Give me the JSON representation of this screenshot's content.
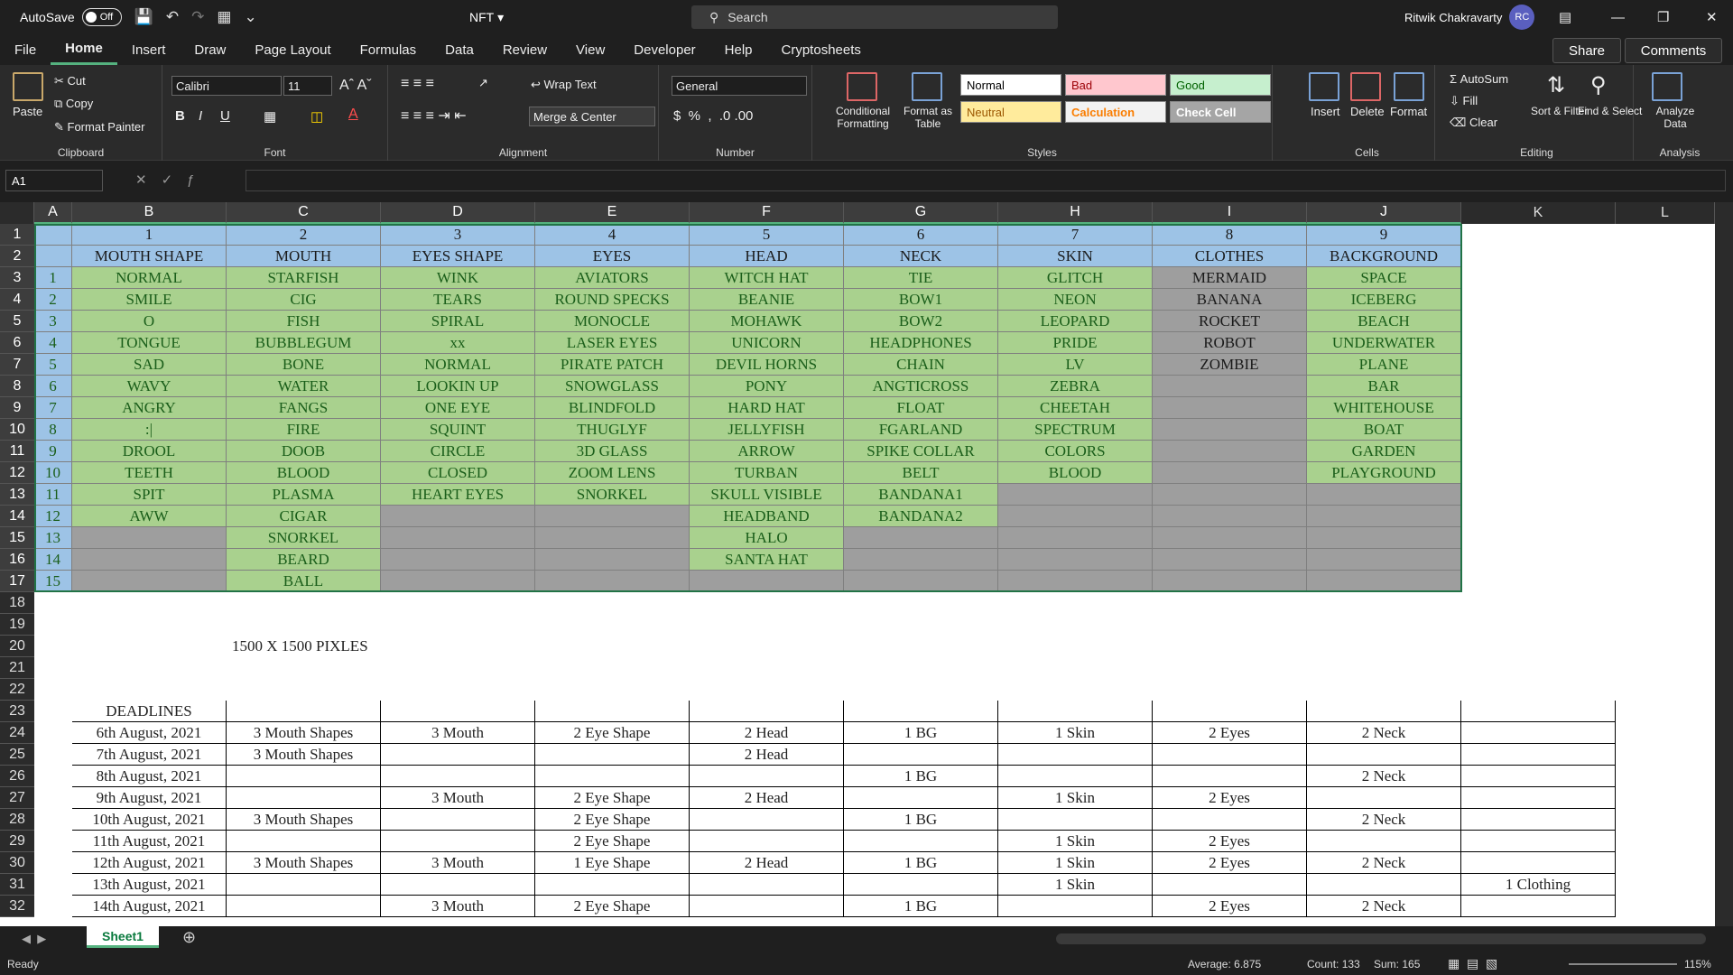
{
  "title": {
    "autosave": "AutoSave",
    "toggle": "Off",
    "doc": "NFT",
    "search": "Search",
    "user": "Ritwik Chakravarty",
    "initials": "RC"
  },
  "menu": [
    "File",
    "Home",
    "Insert",
    "Draw",
    "Page Layout",
    "Formulas",
    "Data",
    "Review",
    "View",
    "Developer",
    "Help",
    "Cryptosheets"
  ],
  "share": "Share",
  "comments": "Comments",
  "ribbon": {
    "paste": "Paste",
    "cut": "Cut",
    "copy": "Copy",
    "format_painter": "Format Painter",
    "clipboard": "Clipboard",
    "font_name": "Calibri",
    "font_size": "11",
    "font": "Font",
    "wrap": "Wrap Text",
    "merge": "Merge & Center",
    "alignment": "Alignment",
    "numfmt": "General",
    "number": "Number",
    "cond": "Conditional Formatting",
    "format_table": "Format as Table",
    "styles": "Styles",
    "s_normal": "Normal",
    "s_bad": "Bad",
    "s_good": "Good",
    "s_neutral": "Neutral",
    "s_calc": "Calculation",
    "s_check": "Check Cell",
    "insert": "Insert",
    "delete": "Delete",
    "format": "Format",
    "cells": "Cells",
    "autosum": "AutoSum",
    "fill": "Fill",
    "clear": "Clear",
    "sort": "Sort & Filter",
    "find": "Find & Select",
    "editing": "Editing",
    "analyze": "Analyze Data",
    "analysis": "Analysis"
  },
  "namebox": "A1",
  "columns": [
    "A",
    "B",
    "C",
    "D",
    "E",
    "F",
    "G",
    "H",
    "I",
    "J",
    "K",
    "L"
  ],
  "rows": {
    "r1": [
      "",
      "1",
      "2",
      "3",
      "4",
      "5",
      "6",
      "7",
      "8",
      "9"
    ],
    "r2": [
      "",
      "MOUTH SHAPE",
      "MOUTH",
      "EYES SHAPE",
      "EYES",
      "HEAD",
      "NECK",
      "SKIN",
      "CLOTHES",
      "BACKGROUND"
    ],
    "r3": [
      "1",
      "NORMAL",
      "STARFISH",
      "WINK",
      "AVIATORS",
      "WITCH HAT",
      "TIE",
      "GLITCH",
      "MERMAID",
      "SPACE"
    ],
    "r4": [
      "2",
      "SMILE",
      "CIG",
      "TEARS",
      "ROUND SPECKS",
      "BEANIE",
      "BOW1",
      "NEON",
      "BANANA",
      "ICEBERG"
    ],
    "r5": [
      "3",
      "O",
      "FISH",
      "SPIRAL",
      "MONOCLE",
      "MOHAWK",
      "BOW2",
      "LEOPARD",
      "ROCKET",
      "BEACH"
    ],
    "r6": [
      "4",
      "TONGUE",
      "BUBBLEGUM",
      "xx",
      "LASER EYES",
      "UNICORN",
      "HEADPHONES",
      "PRIDE",
      "ROBOT",
      "UNDERWATER"
    ],
    "r7": [
      "5",
      "SAD",
      "BONE",
      "NORMAL",
      "PIRATE PATCH",
      "DEVIL HORNS",
      "CHAIN",
      "LV",
      "ZOMBIE",
      "PLANE"
    ],
    "r8": [
      "6",
      "WAVY",
      "WATER",
      "LOOKIN UP",
      "SNOWGLASS",
      "PONY",
      "ANGTICROSS",
      "ZEBRA",
      "",
      "BAR"
    ],
    "r9": [
      "7",
      "ANGRY",
      "FANGS",
      "ONE EYE",
      "BLINDFOLD",
      "HARD HAT",
      "FLOAT",
      "CHEETAH",
      "",
      "WHITEHOUSE"
    ],
    "r10": [
      "8",
      ":|",
      "FIRE",
      "SQUINT",
      "THUGLYF",
      "JELLYFISH",
      "FGARLAND",
      "SPECTRUM",
      "",
      "BOAT"
    ],
    "r11": [
      "9",
      "DROOL",
      "DOOB",
      "CIRCLE",
      "3D GLASS",
      "ARROW",
      "SPIKE COLLAR",
      "COLORS",
      "",
      "GARDEN"
    ],
    "r12": [
      "10",
      "TEETH",
      "BLOOD",
      "CLOSED",
      "ZOOM LENS",
      "TURBAN",
      "BELT",
      "BLOOD",
      "",
      "PLAYGROUND"
    ],
    "r13": [
      "11",
      "SPIT",
      "PLASMA",
      "HEART EYES",
      "SNORKEL",
      "SKULL VISIBLE",
      "BANDANA1",
      "",
      "",
      ""
    ],
    "r14": [
      "12",
      "AWW",
      "CIGAR",
      "",
      "",
      "HEADBAND",
      "BANDANA2",
      "",
      "",
      ""
    ],
    "r15": [
      "13",
      "",
      "SNORKEL",
      "",
      "",
      "HALO",
      "",
      "",
      "",
      ""
    ],
    "r16": [
      "14",
      "",
      "BEARD",
      "",
      "",
      "SANTA HAT",
      "",
      "",
      "",
      ""
    ],
    "r17": [
      "15",
      "",
      "BALL",
      "",
      "",
      "",
      "",
      "",
      "",
      ""
    ]
  },
  "pixels_note": "1500 X 1500  PIXLES",
  "deadlines": {
    "header": "DEADLINES",
    "rows": [
      [
        "6th August, 2021",
        "3 Mouth Shapes",
        "3 Mouth",
        "2 Eye Shape",
        "2 Head",
        "1 BG",
        "1 Skin",
        "2 Eyes",
        "2 Neck",
        ""
      ],
      [
        "7th August, 2021",
        "3 Mouth Shapes",
        "",
        "",
        "2 Head",
        "",
        "",
        "",
        "",
        ""
      ],
      [
        "8th August, 2021",
        "",
        "",
        "",
        "",
        "1 BG",
        "",
        "",
        "2 Neck",
        ""
      ],
      [
        "9th August, 2021",
        "",
        "3 Mouth",
        "2 Eye Shape",
        "2 Head",
        "",
        "1 Skin",
        "2 Eyes",
        "",
        ""
      ],
      [
        "10th August, 2021",
        "3 Mouth Shapes",
        "",
        "2 Eye Shape",
        "",
        "1 BG",
        "",
        "",
        "2 Neck",
        ""
      ],
      [
        "11th August, 2021",
        "",
        "",
        "2 Eye Shape",
        "",
        "",
        "1 Skin",
        "2 Eyes",
        "",
        ""
      ],
      [
        "12th August, 2021",
        "3 Mouth Shapes",
        "3 Mouth",
        "1 Eye Shape",
        "2 Head",
        "1 BG",
        "1 Skin",
        "2 Eyes",
        "2 Neck",
        ""
      ],
      [
        "13th August, 2021",
        "",
        "",
        "",
        "",
        "",
        "1 Skin",
        "",
        "",
        "1 Clothing"
      ],
      [
        "14th August, 2021",
        "",
        "3 Mouth",
        "2 Eye Shape",
        "",
        "1 BG",
        "",
        "2 Eyes",
        "2 Neck",
        ""
      ]
    ]
  },
  "sheet_tab": "Sheet1",
  "status": {
    "ready": "Ready",
    "average": "Average: 6.875",
    "count": "Count: 133",
    "sum": "Sum: 165",
    "zoom": "115%"
  },
  "colors": {
    "green": "#a9d18e",
    "blue": "#9dc3e6",
    "gray": "#9e9e9e",
    "accent": "#55b27f"
  }
}
